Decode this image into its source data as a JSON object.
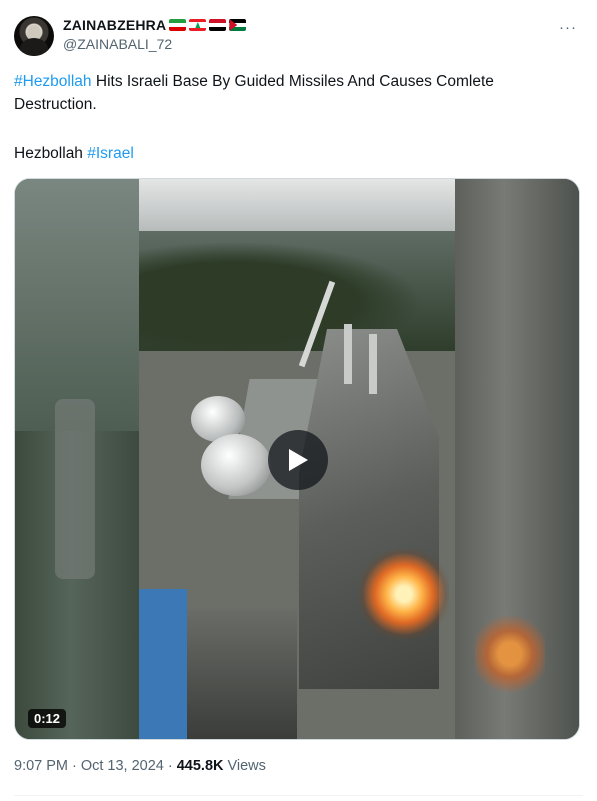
{
  "author": {
    "display_name": "ZAINABZEHRA",
    "handle": "@ZAINABALI_72",
    "flags": [
      "iran-flag",
      "lebanon-flag",
      "yemen-flag",
      "palestine-flag"
    ]
  },
  "more_icon": "···",
  "tweet": {
    "line1_hashtag": "#Hezbollah",
    "line1_rest": " Hits Israeli Base By Guided Missiles And Causes Comlete Destruction.",
    "line2_text": "Hezbollah ",
    "line2_hashtag": "#Israel"
  },
  "media": {
    "duration": "0:12",
    "play_icon": "play-icon"
  },
  "meta": {
    "time": "9:07 PM",
    "separator1": "·",
    "date": "Oct 13, 2024",
    "separator2": "·",
    "views_count": "445.8K",
    "views_label": "Views"
  },
  "colors": {
    "link": "#1d9bf0",
    "secondary_text": "#536471",
    "primary_text": "#0f1419"
  }
}
